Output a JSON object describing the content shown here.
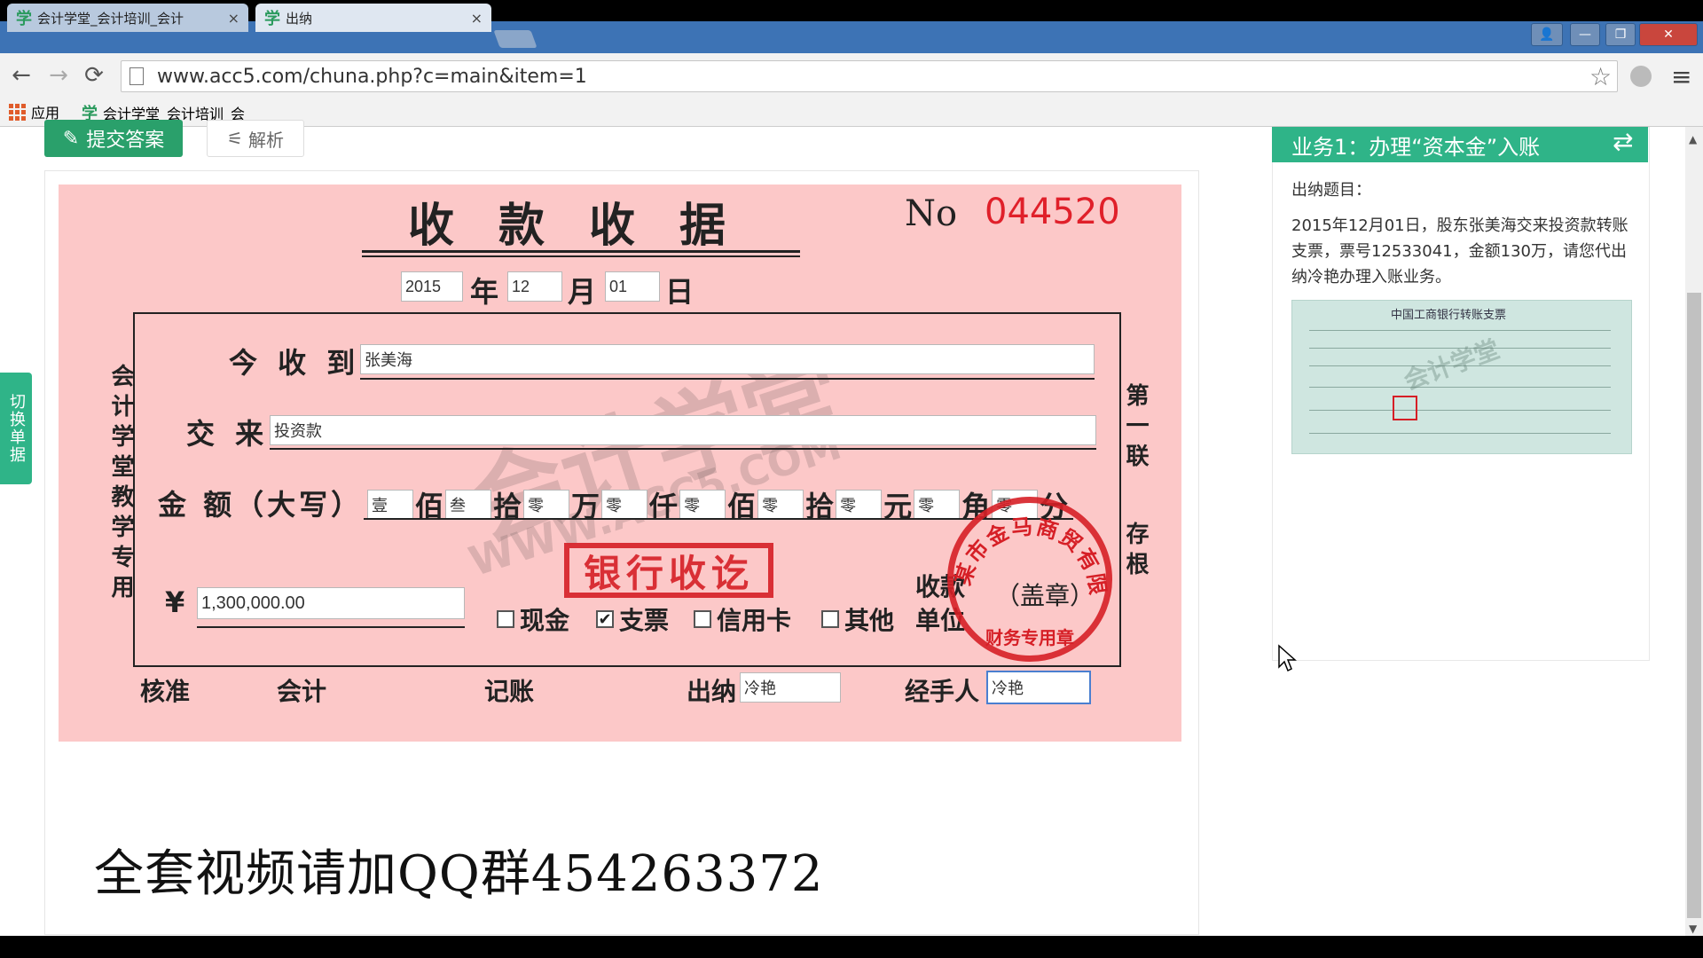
{
  "browser": {
    "tabs": [
      {
        "title": "会计学堂_会计培训_会计",
        "active": false
      },
      {
        "title": "出纳",
        "active": true
      }
    ],
    "url": "www.acc5.com/chuna.php?c=main&item=1",
    "bookmarks": [
      {
        "label": "应用"
      },
      {
        "label": "会计学堂_会计培训_会"
      }
    ]
  },
  "toolbar": {
    "submit_label": "提交答案",
    "parse_label": "解析"
  },
  "side_tab_label": "切换单据",
  "receipt": {
    "title": "收款收据",
    "no_label": "No",
    "no_value": "044520",
    "date": {
      "year": "2015",
      "year_label": "年",
      "month": "12",
      "month_label": "月",
      "day": "01",
      "day_label": "日"
    },
    "left_vertical": "会计学堂教学专用",
    "right_vertical_1": "第一联",
    "right_vertical_2": "存根",
    "received_from_label": "今 收 到",
    "received_from_value": "张美海",
    "paid_for_label": "交 来",
    "paid_for_value": "投资款",
    "amount_words_label": "金 额（大写）",
    "amount_digits": [
      {
        "value": "壹",
        "unit": "佰"
      },
      {
        "value": "叁",
        "unit": "拾"
      },
      {
        "value": "零",
        "unit": "万"
      },
      {
        "value": "零",
        "unit": "仟"
      },
      {
        "value": "零",
        "unit": "佰"
      },
      {
        "value": "零",
        "unit": "拾"
      },
      {
        "value": "零",
        "unit": "元"
      },
      {
        "value": "零",
        "unit": "角"
      },
      {
        "value": "零",
        "unit": "分"
      }
    ],
    "currency_symbol": "¥",
    "amount_number": "1,300,000.00",
    "payment_types": [
      {
        "label": "现金",
        "checked": false
      },
      {
        "label": "支票",
        "checked": true
      },
      {
        "label": "信用卡",
        "checked": false
      },
      {
        "label": "其他",
        "checked": false
      }
    ],
    "payee_unit_label_1": "收款",
    "payee_unit_label_2": "单位",
    "seal_label": "（盖章）",
    "bank_stamp": "银行收讫",
    "company_seal_top": "某市金马商贸有限公司",
    "company_seal_bottom": "财务专用章",
    "signatures": {
      "approve_label": "核准",
      "accounting_label": "会计",
      "bookkeeping_label": "记账",
      "cashier_label": "出纳",
      "cashier_value": "冷艳",
      "handler_label": "经手人",
      "handler_value": "冷艳"
    },
    "watermark_1": "会计学堂",
    "watermark_2": "WWW.ACC5.COM"
  },
  "right_panel": {
    "header": "业务1：办理“资本金”入账",
    "question_label": "出纳题目：",
    "question_text": "2015年12月01日，股东张美海交来投资款转账支票，票号12533041，金额130万，请您代出纳冷艳办理入账业务。",
    "cheque_title": "中国工商银行转账支票",
    "cheque_watermark": "会计学堂"
  },
  "caption": "全套视频请加QQ群454263372",
  "colors": {
    "accent_green": "#2fb488",
    "receipt_pink": "#fcc8c8",
    "stamp_red": "#d61f26",
    "number_red": "#e0202a"
  }
}
